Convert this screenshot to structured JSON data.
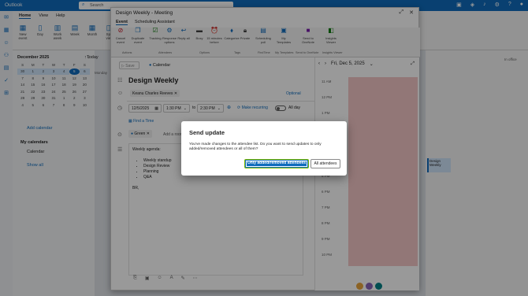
{
  "app": {
    "title": "Outlook",
    "search_placeholder": "Search"
  },
  "main_tabs": [
    "Home",
    "View",
    "Help"
  ],
  "main_ribbon": [
    "New event",
    "Day",
    "Work week",
    "Week",
    "Month",
    "Split view",
    "Filter",
    "Share",
    "Print"
  ],
  "mini_calendar": {
    "month_label": "December 2025",
    "weekdays": [
      "S",
      "M",
      "T",
      "W",
      "T",
      "F",
      "S"
    ],
    "weeks": [
      [
        "30",
        "1",
        "2",
        "3",
        "4",
        "5",
        "6"
      ],
      [
        "7",
        "8",
        "9",
        "10",
        "11",
        "12",
        "13"
      ],
      [
        "14",
        "15",
        "16",
        "17",
        "18",
        "19",
        "20"
      ],
      [
        "21",
        "22",
        "23",
        "24",
        "25",
        "26",
        "27"
      ],
      [
        "28",
        "29",
        "30",
        "31",
        "1",
        "2",
        "3"
      ],
      [
        "4",
        "5",
        "6",
        "7",
        "8",
        "9",
        "10"
      ]
    ]
  },
  "left_pane": {
    "add_calendar": "Add calendar",
    "my_calendars": "My calendars",
    "calendar_item": "Calendar",
    "show_all": "Show all"
  },
  "today_label": "Today",
  "day_col": {
    "weekday": "Monday",
    "date": "1"
  },
  "meeting": {
    "window_title": "Design Weekly - Meeting",
    "tabs": [
      "Event",
      "Scheduling Assistant"
    ],
    "ribbon": [
      {
        "label": "Cancel event",
        "icon": "cancel-icon"
      },
      {
        "label": "Duplicate event",
        "icon": "duplicate-icon"
      },
      {
        "label": "Tracking",
        "icon": "tracking-icon"
      },
      {
        "label": "Response options",
        "icon": "response-icon"
      },
      {
        "label": "Reply all",
        "icon": "reply-all-icon"
      },
      {
        "label": "Busy",
        "icon": "busy-icon"
      },
      {
        "label": "15 minutes before",
        "icon": "reminder-icon"
      },
      {
        "label": "Categorize",
        "icon": "tag-icon"
      },
      {
        "label": "Private",
        "icon": "lock-icon"
      },
      {
        "label": "Scheduling poll",
        "icon": "poll-icon"
      },
      {
        "label": "My Templates",
        "icon": "template-icon"
      },
      {
        "label": "Send to OneNote",
        "icon": "onenote-icon"
      },
      {
        "label": "Insights Viewer",
        "icon": "insights-icon"
      }
    ],
    "groups": [
      "Actions",
      "Attendees",
      "Options",
      "Tags",
      "FindTime",
      "My Templates",
      "Send to OneNote",
      "Insights Viewer"
    ],
    "save_label": "Save",
    "calendar_label": "Calendar",
    "event_title": "Design Weekly",
    "attendee": "Keanu Charles Reeves",
    "optional_label": "Optional",
    "start_date": "12/5/2025",
    "start_time": "1:30 PM",
    "to_label": "to",
    "end_time": "2:30 PM",
    "recurring_label": "Make recurring",
    "allday_label": "All day",
    "find_time_label": "Find a Time",
    "status": "Green",
    "add_room": "Add a room",
    "body_lines": [
      "Weekly agenda:",
      "",
      "Weekly standup",
      "Design Review",
      "Planning",
      "Q&A",
      "",
      "BR,"
    ],
    "cal_date": "Fri, Dec 5, 2025",
    "time_slots": [
      "11 AM",
      "12 PM",
      "1 PM",
      "2 PM",
      "3 PM",
      "4 PM",
      "5 PM",
      "6 PM",
      "7 PM",
      "8 PM",
      "9 PM",
      "10 PM"
    ],
    "event_snippet": "Design Weekly"
  },
  "right_pane": {
    "item": "Design Weekly",
    "sub": "In office"
  },
  "dialog": {
    "title": "Send update",
    "body": "You've made changes to the attendee list. Do you want to send updates to only added/removed attendees or all of them?",
    "primary": "Only added/removed attendees",
    "secondary": "All attendees"
  },
  "colors": {
    "accent": "#0f6cbd",
    "busy": "#f3c7c7",
    "focus": "#7fba00"
  }
}
